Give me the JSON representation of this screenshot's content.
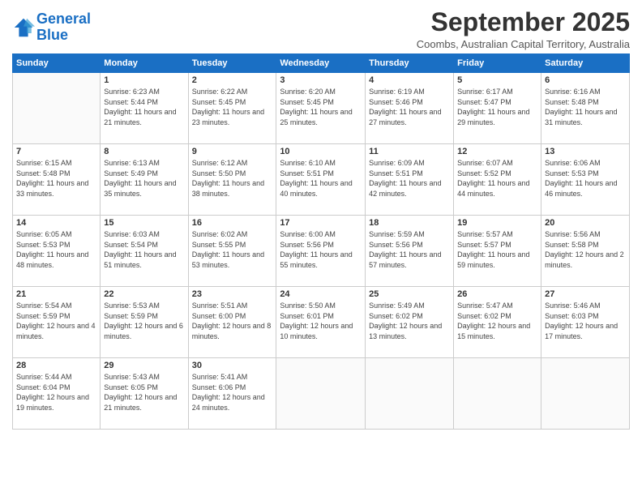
{
  "header": {
    "logo_line1": "General",
    "logo_line2": "Blue",
    "title": "September 2025",
    "subtitle": "Coombs, Australian Capital Territory, Australia"
  },
  "days_of_week": [
    "Sunday",
    "Monday",
    "Tuesday",
    "Wednesday",
    "Thursday",
    "Friday",
    "Saturday"
  ],
  "weeks": [
    [
      {
        "day": "",
        "sunrise": "",
        "sunset": "",
        "daylight": ""
      },
      {
        "day": "1",
        "sunrise": "Sunrise: 6:23 AM",
        "sunset": "Sunset: 5:44 PM",
        "daylight": "Daylight: 11 hours and 21 minutes."
      },
      {
        "day": "2",
        "sunrise": "Sunrise: 6:22 AM",
        "sunset": "Sunset: 5:45 PM",
        "daylight": "Daylight: 11 hours and 23 minutes."
      },
      {
        "day": "3",
        "sunrise": "Sunrise: 6:20 AM",
        "sunset": "Sunset: 5:45 PM",
        "daylight": "Daylight: 11 hours and 25 minutes."
      },
      {
        "day": "4",
        "sunrise": "Sunrise: 6:19 AM",
        "sunset": "Sunset: 5:46 PM",
        "daylight": "Daylight: 11 hours and 27 minutes."
      },
      {
        "day": "5",
        "sunrise": "Sunrise: 6:17 AM",
        "sunset": "Sunset: 5:47 PM",
        "daylight": "Daylight: 11 hours and 29 minutes."
      },
      {
        "day": "6",
        "sunrise": "Sunrise: 6:16 AM",
        "sunset": "Sunset: 5:48 PM",
        "daylight": "Daylight: 11 hours and 31 minutes."
      }
    ],
    [
      {
        "day": "7",
        "sunrise": "Sunrise: 6:15 AM",
        "sunset": "Sunset: 5:48 PM",
        "daylight": "Daylight: 11 hours and 33 minutes."
      },
      {
        "day": "8",
        "sunrise": "Sunrise: 6:13 AM",
        "sunset": "Sunset: 5:49 PM",
        "daylight": "Daylight: 11 hours and 35 minutes."
      },
      {
        "day": "9",
        "sunrise": "Sunrise: 6:12 AM",
        "sunset": "Sunset: 5:50 PM",
        "daylight": "Daylight: 11 hours and 38 minutes."
      },
      {
        "day": "10",
        "sunrise": "Sunrise: 6:10 AM",
        "sunset": "Sunset: 5:51 PM",
        "daylight": "Daylight: 11 hours and 40 minutes."
      },
      {
        "day": "11",
        "sunrise": "Sunrise: 6:09 AM",
        "sunset": "Sunset: 5:51 PM",
        "daylight": "Daylight: 11 hours and 42 minutes."
      },
      {
        "day": "12",
        "sunrise": "Sunrise: 6:07 AM",
        "sunset": "Sunset: 5:52 PM",
        "daylight": "Daylight: 11 hours and 44 minutes."
      },
      {
        "day": "13",
        "sunrise": "Sunrise: 6:06 AM",
        "sunset": "Sunset: 5:53 PM",
        "daylight": "Daylight: 11 hours and 46 minutes."
      }
    ],
    [
      {
        "day": "14",
        "sunrise": "Sunrise: 6:05 AM",
        "sunset": "Sunset: 5:53 PM",
        "daylight": "Daylight: 11 hours and 48 minutes."
      },
      {
        "day": "15",
        "sunrise": "Sunrise: 6:03 AM",
        "sunset": "Sunset: 5:54 PM",
        "daylight": "Daylight: 11 hours and 51 minutes."
      },
      {
        "day": "16",
        "sunrise": "Sunrise: 6:02 AM",
        "sunset": "Sunset: 5:55 PM",
        "daylight": "Daylight: 11 hours and 53 minutes."
      },
      {
        "day": "17",
        "sunrise": "Sunrise: 6:00 AM",
        "sunset": "Sunset: 5:56 PM",
        "daylight": "Daylight: 11 hours and 55 minutes."
      },
      {
        "day": "18",
        "sunrise": "Sunrise: 5:59 AM",
        "sunset": "Sunset: 5:56 PM",
        "daylight": "Daylight: 11 hours and 57 minutes."
      },
      {
        "day": "19",
        "sunrise": "Sunrise: 5:57 AM",
        "sunset": "Sunset: 5:57 PM",
        "daylight": "Daylight: 11 hours and 59 minutes."
      },
      {
        "day": "20",
        "sunrise": "Sunrise: 5:56 AM",
        "sunset": "Sunset: 5:58 PM",
        "daylight": "Daylight: 12 hours and 2 minutes."
      }
    ],
    [
      {
        "day": "21",
        "sunrise": "Sunrise: 5:54 AM",
        "sunset": "Sunset: 5:59 PM",
        "daylight": "Daylight: 12 hours and 4 minutes."
      },
      {
        "day": "22",
        "sunrise": "Sunrise: 5:53 AM",
        "sunset": "Sunset: 5:59 PM",
        "daylight": "Daylight: 12 hours and 6 minutes."
      },
      {
        "day": "23",
        "sunrise": "Sunrise: 5:51 AM",
        "sunset": "Sunset: 6:00 PM",
        "daylight": "Daylight: 12 hours and 8 minutes."
      },
      {
        "day": "24",
        "sunrise": "Sunrise: 5:50 AM",
        "sunset": "Sunset: 6:01 PM",
        "daylight": "Daylight: 12 hours and 10 minutes."
      },
      {
        "day": "25",
        "sunrise": "Sunrise: 5:49 AM",
        "sunset": "Sunset: 6:02 PM",
        "daylight": "Daylight: 12 hours and 13 minutes."
      },
      {
        "day": "26",
        "sunrise": "Sunrise: 5:47 AM",
        "sunset": "Sunset: 6:02 PM",
        "daylight": "Daylight: 12 hours and 15 minutes."
      },
      {
        "day": "27",
        "sunrise": "Sunrise: 5:46 AM",
        "sunset": "Sunset: 6:03 PM",
        "daylight": "Daylight: 12 hours and 17 minutes."
      }
    ],
    [
      {
        "day": "28",
        "sunrise": "Sunrise: 5:44 AM",
        "sunset": "Sunset: 6:04 PM",
        "daylight": "Daylight: 12 hours and 19 minutes."
      },
      {
        "day": "29",
        "sunrise": "Sunrise: 5:43 AM",
        "sunset": "Sunset: 6:05 PM",
        "daylight": "Daylight: 12 hours and 21 minutes."
      },
      {
        "day": "30",
        "sunrise": "Sunrise: 5:41 AM",
        "sunset": "Sunset: 6:06 PM",
        "daylight": "Daylight: 12 hours and 24 minutes."
      },
      {
        "day": "",
        "sunrise": "",
        "sunset": "",
        "daylight": ""
      },
      {
        "day": "",
        "sunrise": "",
        "sunset": "",
        "daylight": ""
      },
      {
        "day": "",
        "sunrise": "",
        "sunset": "",
        "daylight": ""
      },
      {
        "day": "",
        "sunrise": "",
        "sunset": "",
        "daylight": ""
      }
    ]
  ]
}
